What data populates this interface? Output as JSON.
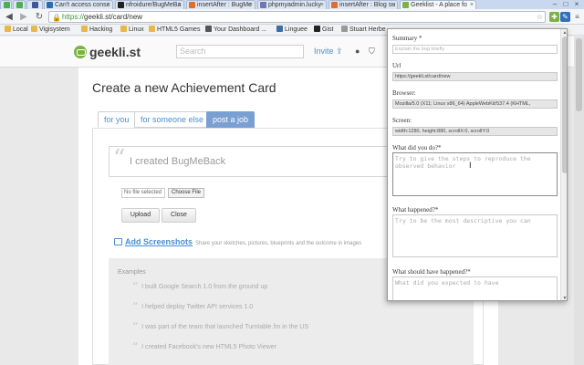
{
  "browser": {
    "tabs": [
      {
        "label": "Can't access consc",
        "favicon_color": "#2b6cb0"
      },
      {
        "label": "nfroidure/BugMeBa",
        "favicon_color": "#222222"
      },
      {
        "label": "insertAfter : BugMe",
        "favicon_color": "#e36b2c"
      },
      {
        "label": "phpmyadmin.lucky",
        "favicon_color": "#6c78af"
      },
      {
        "label": "insertAfter : Blog su",
        "favicon_color": "#e36b2c"
      },
      {
        "label": "Geeklist - A place fo",
        "favicon_color": "#7ab342"
      }
    ],
    "active_tab": 5,
    "url_scheme": "https://",
    "url_rest": "geekli.st/card/new",
    "bookmarks": [
      {
        "label": "Local",
        "color": "#e8b84a"
      },
      {
        "label": "Vigisystem",
        "color": "#e8b84a"
      },
      {
        "label": "Hacking",
        "color": "#e8b84a"
      },
      {
        "label": "Linux",
        "color": "#e8b84a"
      },
      {
        "label": "HTML5 Games",
        "color": "#e8b84a"
      },
      {
        "label": "Your Dashboard ...",
        "color": "#555555"
      },
      {
        "label": "Linguee",
        "color": "#3a6ea5"
      },
      {
        "label": "Gist",
        "color": "#222222"
      },
      {
        "label": "Stuart Herbe",
        "color": "#999999"
      }
    ]
  },
  "site": {
    "logo": "geekli.st",
    "search_placeholder": "Search",
    "invite_label": "Invite"
  },
  "main": {
    "title": "Create a new Achievement Card",
    "tabs": [
      "for you",
      "for someone else",
      "post a job"
    ],
    "card_placeholder": "I created BugMeBack",
    "file_name": "No file selected",
    "choose_file": "Choose File",
    "upload": "Upload",
    "close": "Close",
    "add_screenshots": "Add Screenshots",
    "add_screenshots_desc": "Share your sketches, pictures, blueprints and the outcome in images",
    "examples_title": "Examples",
    "examples": [
      "I built Google Search 1.0 from the ground up",
      "I helped deploy Twitter API services 1.0",
      "I was part of the team that launched Turntable.fm in the US",
      "I created Facebook's new HTML5 Photo Viewer"
    ]
  },
  "popup": {
    "summary_label": "Summary *",
    "summary_placeholder": "Explain the bug briefly",
    "url_label": "Url",
    "url_value": "https://geekli.st/card/new",
    "browser_label": "Browser:",
    "browser_value": "Mozilla/5.0 (X11; Linux x86_64) AppleWebKit/537.4 (KHTML,",
    "screen_label": "Screen:",
    "screen_value": "width:1280, height:880, scrollX:0, scrollY:0",
    "did_label": "What did you do?*",
    "did_placeholder": "Try to give the steps to reproduce the observed behavior",
    "happened_label": "What happened?*",
    "happened_placeholder": "Try to be the most descriptive you can",
    "should_label": "What should have happened?*",
    "should_placeholder": "What did you expected to have"
  }
}
